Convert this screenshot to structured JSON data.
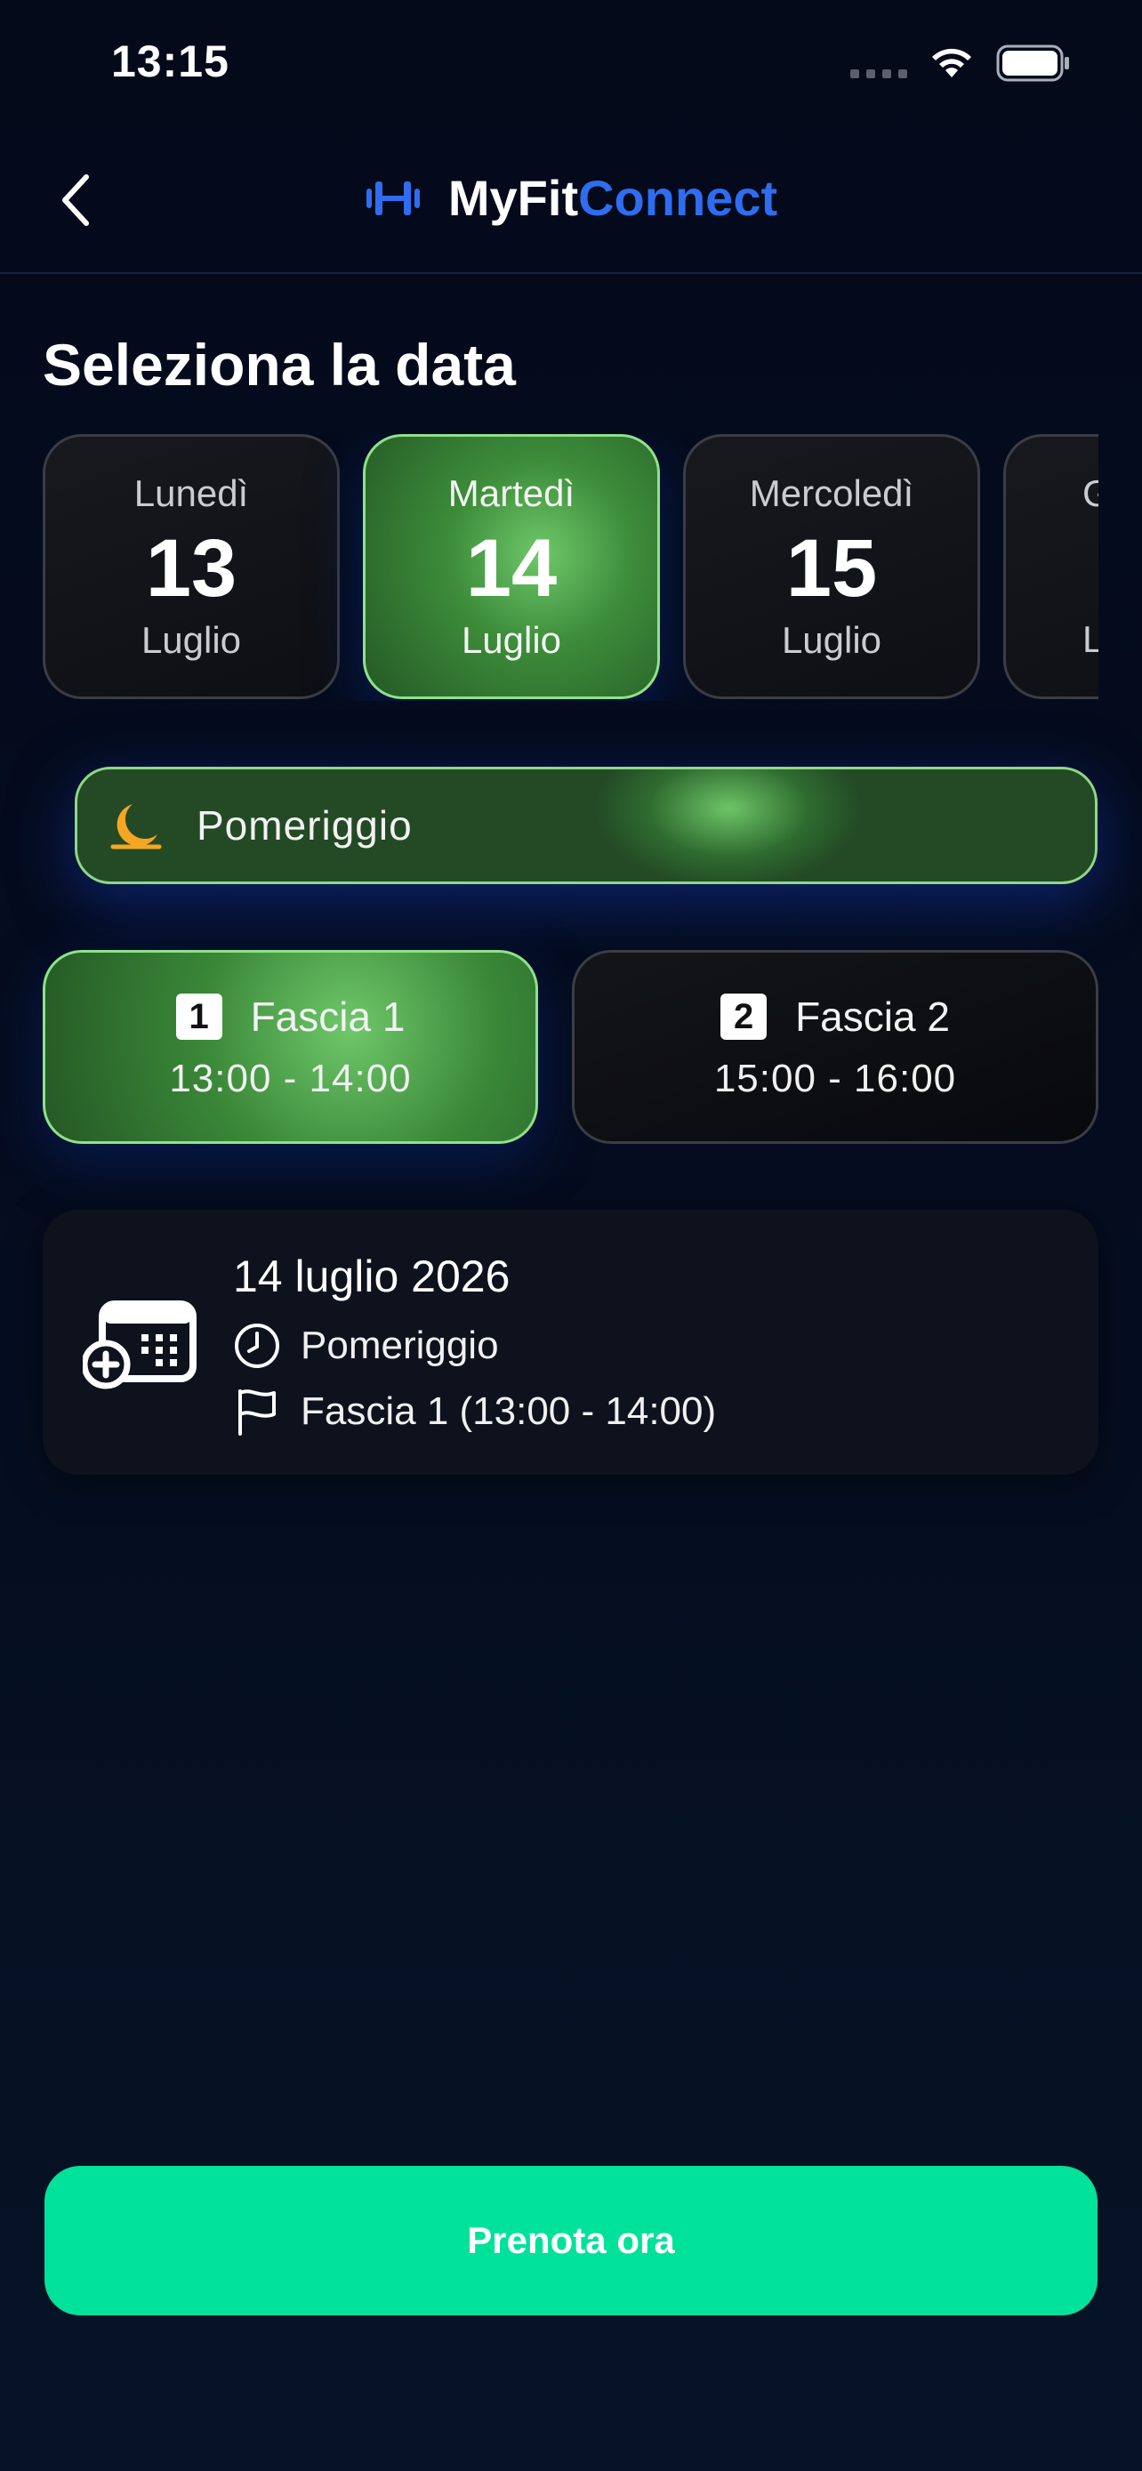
{
  "status_bar": {
    "time": "13:15"
  },
  "header": {
    "brand_prefix": "MyFit",
    "brand_accent": "Connect",
    "back_icon": "chevron-left-icon",
    "logo_icon": "dumbbell-icon"
  },
  "page_title": "Seleziona la data",
  "dates": [
    {
      "weekday": "Lunedì",
      "day": "13",
      "month": "Luglio",
      "selected": false
    },
    {
      "weekday": "Martedì",
      "day": "14",
      "month": "Luglio",
      "selected": true
    },
    {
      "weekday": "Mercoledì",
      "day": "15",
      "month": "Luglio",
      "selected": false
    },
    {
      "weekday": "G",
      "day": "",
      "month": "L",
      "selected": false
    }
  ],
  "period": {
    "label": "Pomeriggio",
    "icon": "moon-icon",
    "icon_color": "#f5a623"
  },
  "slots": [
    {
      "number": "1",
      "name": "Fascia 1",
      "time": "13:00 - 14:00",
      "selected": true
    },
    {
      "number": "2",
      "name": "Fascia 2",
      "time": "15:00 - 16:00",
      "selected": false
    }
  ],
  "summary": {
    "date": "14 luglio 2026",
    "period": "Pomeriggio",
    "slot": "Fascia 1 (13:00 - 14:00)",
    "icon": "calendar-add-icon"
  },
  "book_button": {
    "label": "Prenota ora",
    "color": "#00e29a"
  },
  "colors": {
    "accent_blue": "#2f6df0",
    "selected_green": "#3d8d3a",
    "selected_border": "#8fe28a"
  }
}
